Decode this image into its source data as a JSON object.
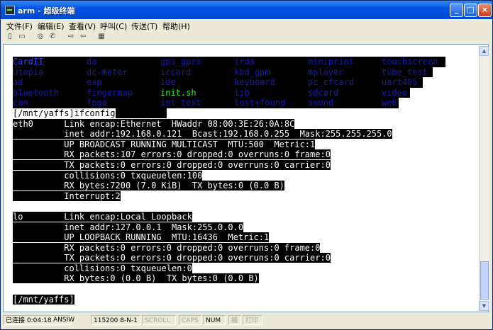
{
  "window": {
    "title": "arm - 超级终端"
  },
  "menu": [
    "文件(F)",
    "编辑(E)",
    "查看(V)",
    "呼叫(C)",
    "传送(T)",
    "帮助(H)"
  ],
  "toolbar_icons": [
    "new-icon",
    "open-icon",
    "disconnect-icon",
    "call-icon",
    "send-icon",
    "receive-icon",
    "properties-icon"
  ],
  "listing": [
    [
      "CardII",
      "da",
      "gps_gprs",
      "irda",
      "miniprint",
      "touchscreen"
    ],
    [
      "Utopia",
      "dc-meter",
      "iccard",
      "kbd_gpm",
      "mplayer",
      "tube_test"
    ],
    [
      "ad",
      "exp",
      "ide",
      "keyboard",
      "pc_cfcard",
      "uart485"
    ],
    [
      "bluetooth",
      "fingermap",
      "init.sh",
      "lib",
      "sdcard",
      "video"
    ],
    [
      "can",
      "fpga",
      "int_test",
      "lost+found",
      "sound",
      "web"
    ]
  ],
  "prompt_cmd": "[/mnt/yaffs]ifconfig",
  "eth0_lines": [
    "eth0      Link encap:Ethernet  HWaddr 08:00:3E:26:0A:8C",
    "          inet addr:192.168.0.121  Bcast:192.168.0.255  Mask:255.255.255.0",
    "          UP BROADCAST RUNNING MULTICAST  MTU:500  Metric:1",
    "          RX packets:107 errors:0 dropped:0 overruns:0 frame:0",
    "          TX packets:0 errors:0 dropped:0 overruns:0 carrier:0",
    "          collisions:0 txqueuelen:100",
    "          RX bytes:7200 (7.0 KiB)  TX bytes:0 (0.0 B)",
    "          Interrupt:2"
  ],
  "lo_lines": [
    "lo        Link encap:Local Loopback",
    "          inet addr:127.0.0.1  Mask:255.0.0.0",
    "          UP LOOPBACK RUNNING  MTU:16436  Metric:1",
    "          RX packets:0 errors:0 dropped:0 overruns:0 frame:0",
    "          TX packets:0 errors:0 dropped:0 overruns:0 carrier:0",
    "          collisions:0 txqueuelen:0",
    "          RX bytes:0 (0.0 B)  TX bytes:0 (0.0 B)"
  ],
  "prompt_end": "[/mnt/yaffs]",
  "status": {
    "connected": "已连接 0:04:18",
    "emulation": "ANSIW",
    "settings": "115200 8-N-1",
    "scroll": "SCROLL",
    "caps": "CAPS",
    "num": "NUM",
    "capture": "捕",
    "print": "打印"
  }
}
